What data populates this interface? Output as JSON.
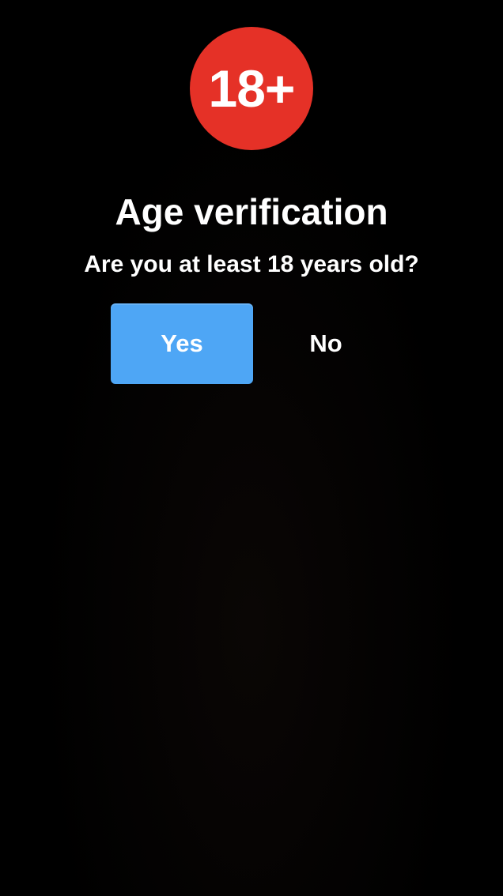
{
  "badge": {
    "text": "18+",
    "color": "#e53127"
  },
  "title": "Age verification",
  "question": "Are you at least 18 years old?",
  "buttons": {
    "yes_label": "Yes",
    "no_label": "No",
    "yes_color": "#4ea6f5"
  },
  "background_color": "#000000"
}
